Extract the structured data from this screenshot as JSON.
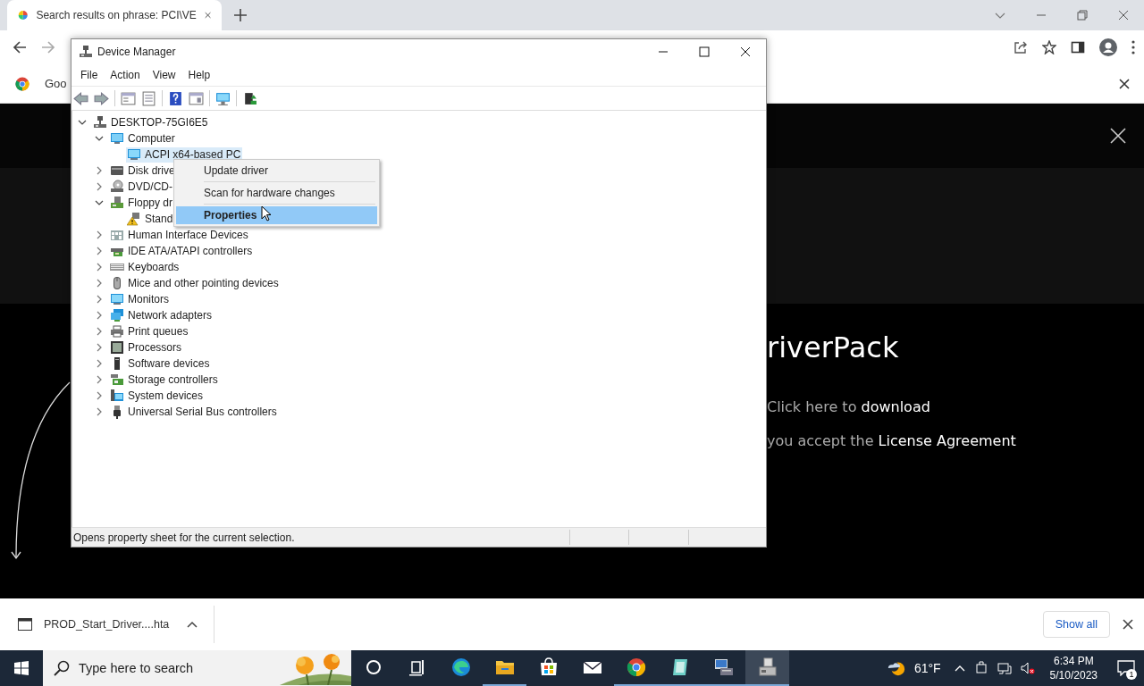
{
  "browser": {
    "tab": {
      "title": "Search results on phrase: PCI\\VE"
    },
    "infobar": {
      "text": "Goo"
    }
  },
  "page": {
    "heading": "riverPack",
    "download_line": {
      "prefix": "Click here to",
      "link": "download"
    },
    "license_line": {
      "prefix": "you accept the",
      "link": "License Agreement"
    }
  },
  "device_manager": {
    "title": "Device Manager",
    "menu": [
      "File",
      "Action",
      "View",
      "Help"
    ],
    "toolbar": [
      {
        "kind": "back"
      },
      {
        "kind": "forward"
      },
      {
        "kind": "sheet"
      },
      {
        "kind": "list"
      },
      {
        "kind": "help"
      },
      {
        "kind": "panel"
      },
      {
        "kind": "scan"
      },
      {
        "kind": "update"
      }
    ],
    "tree": [
      {
        "label": "DESKTOP-75GI6E5",
        "kind": "root",
        "expanded": true,
        "selected": false,
        "children": [
          {
            "label": "Computer",
            "kind": "computer",
            "expanded": true,
            "selected": false,
            "children": [
              {
                "label": "ACPI x64-based PC",
                "kind": "monitor",
                "selected": true
              }
            ]
          },
          {
            "label": "Disk drive",
            "kind": "disk",
            "expanded": false,
            "selected": false
          },
          {
            "label": "DVD/CD-",
            "kind": "dvd",
            "expanded": false,
            "selected": false
          },
          {
            "label": "Floppy dr",
            "kind": "floppy",
            "expanded": true,
            "selected": false,
            "children": [
              {
                "label": "Stand",
                "kind": "warning",
                "selected": false
              }
            ]
          },
          {
            "label": "Human Interface Devices",
            "kind": "hid",
            "expanded": false,
            "selected": false
          },
          {
            "label": "IDE ATA/ATAPI controllers",
            "kind": "ide",
            "expanded": false,
            "selected": false
          },
          {
            "label": "Keyboards",
            "kind": "keyboard",
            "expanded": false,
            "selected": false
          },
          {
            "label": "Mice and other pointing devices",
            "kind": "mouse",
            "expanded": false,
            "selected": false
          },
          {
            "label": "Monitors",
            "kind": "monitor",
            "expanded": false,
            "selected": false
          },
          {
            "label": "Network adapters",
            "kind": "network",
            "expanded": false,
            "selected": false
          },
          {
            "label": "Print queues",
            "kind": "printer",
            "expanded": false,
            "selected": false
          },
          {
            "label": "Processors",
            "kind": "processor",
            "expanded": false,
            "selected": false
          },
          {
            "label": "Software devices",
            "kind": "software",
            "expanded": false,
            "selected": false
          },
          {
            "label": "Storage controllers",
            "kind": "storage",
            "expanded": false,
            "selected": false
          },
          {
            "label": "System devices",
            "kind": "system",
            "expanded": false,
            "selected": false
          },
          {
            "label": "Universal Serial Bus controllers",
            "kind": "usb",
            "expanded": false,
            "selected": false
          }
        ]
      }
    ],
    "context_menu": [
      {
        "label": "Update driver",
        "selected": false
      },
      {
        "label": "Scan for hardware changes",
        "selected": false
      },
      {
        "label": "Properties",
        "selected": true
      }
    ],
    "status": "Opens property sheet for the current selection."
  },
  "downloads": {
    "file": "PROD_Start_Driver....hta",
    "show_all": "Show all"
  },
  "taskbar": {
    "search_placeholder": "Type here to search",
    "apps": [
      {
        "kind": "cortana",
        "running": false,
        "active": false
      },
      {
        "kind": "taskview",
        "running": false,
        "active": false
      },
      {
        "kind": "edge",
        "running": false,
        "active": false
      },
      {
        "kind": "explorer",
        "running": true,
        "active": false
      },
      {
        "kind": "store",
        "running": false,
        "active": false
      },
      {
        "kind": "mail",
        "running": false,
        "active": false
      },
      {
        "kind": "chrome",
        "running": true,
        "active": false
      },
      {
        "kind": "notepad",
        "running": true,
        "active": false
      },
      {
        "kind": "netapp",
        "running": true,
        "active": false
      },
      {
        "kind": "devmgr",
        "running": true,
        "active": true
      }
    ],
    "weather": "61°F",
    "time": "6:34 PM",
    "date": "5/10/2023",
    "notifications": "1"
  }
}
